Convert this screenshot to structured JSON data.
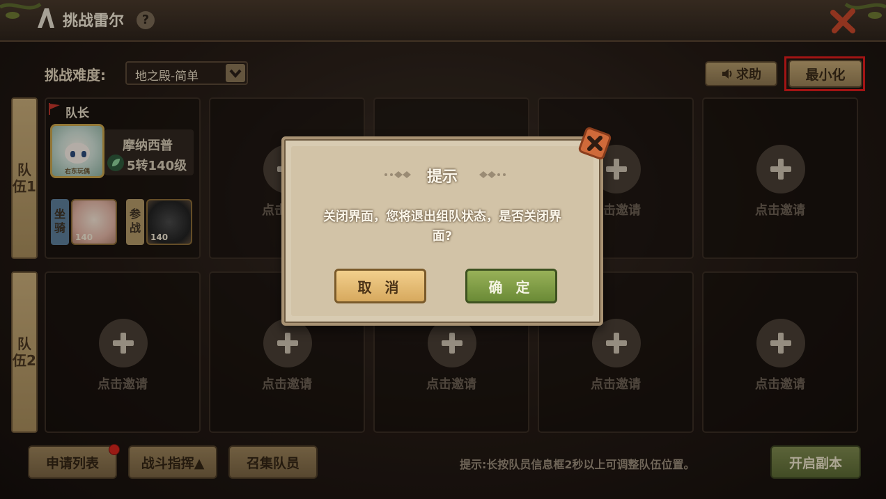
{
  "header": {
    "title": "挑战雷尔",
    "help_icon": "?",
    "close_icon": "close-x-icon"
  },
  "difficulty": {
    "label": "挑战难度:",
    "selected": "地之殿-简单"
  },
  "top_buttons": {
    "help": "求助",
    "minimize": "最小化"
  },
  "teams": [
    {
      "label": "队伍1"
    },
    {
      "label": "队伍2"
    }
  ],
  "captain": {
    "role_label": "队长",
    "name": "摩纳西普",
    "level": "5转140级",
    "avatar_caption": "右东玩偶",
    "mount_label": "坐骑",
    "mount_level": "140",
    "battle_label": "参战",
    "battle_level": "140"
  },
  "slot_invite_text": "点击邀请",
  "bottom": {
    "apply_list": "申请列表",
    "battle_command": "战斗指挥▲",
    "summon": "召集队员",
    "hint": "提示:长按队员信息框2秒以上可调整队伍位置。",
    "start": "开启副本"
  },
  "dialog": {
    "title": "提示",
    "message": "关闭界面，您将退出组队状态，是否关闭界面?",
    "cancel": "取 消",
    "confirm": "确 定"
  },
  "colors": {
    "highlight": "#e11d1d",
    "confirm_green": "#6a8a36",
    "cancel_tan": "#d7a95e"
  }
}
